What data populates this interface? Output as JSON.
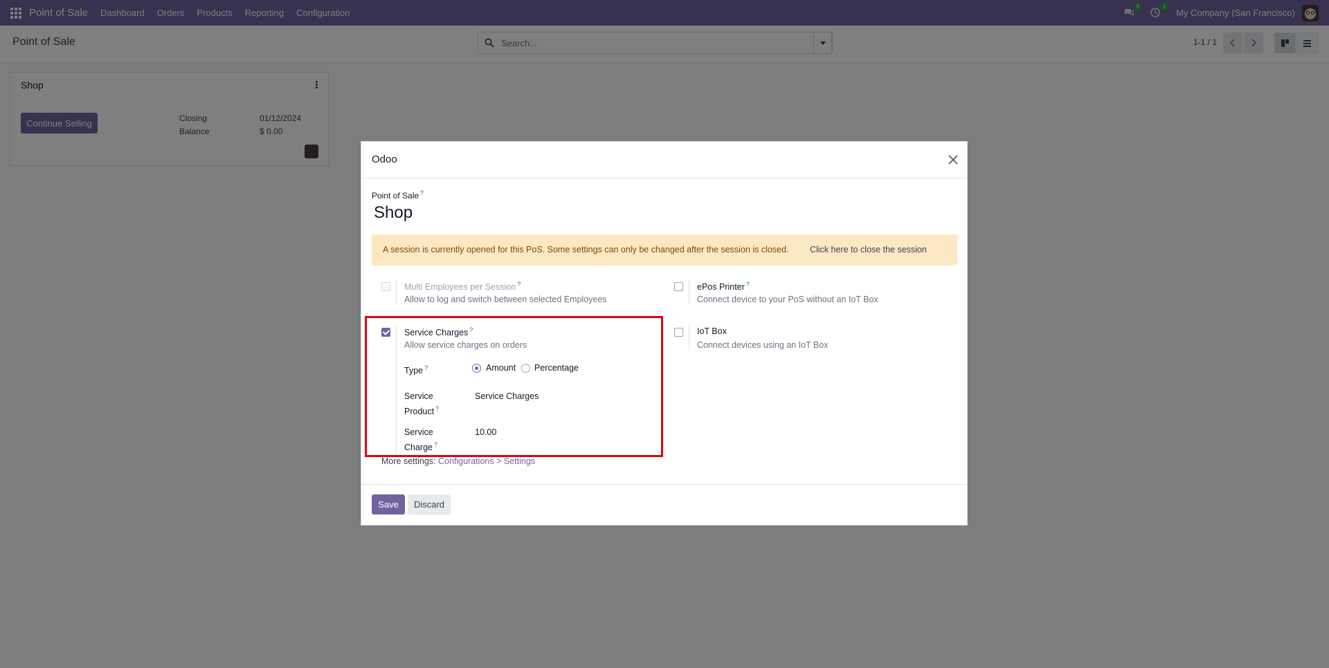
{
  "navbar": {
    "app_name": "Point of Sale",
    "menu": [
      "Dashboard",
      "Orders",
      "Products",
      "Reporting",
      "Configuration"
    ],
    "messages_count": "5",
    "activities_count": "1",
    "company": "My Company (San Francisco)"
  },
  "control_panel": {
    "title": "Point of Sale",
    "search_placeholder": "Search...",
    "pager": "1-1 / 1"
  },
  "kanban": {
    "title": "Shop",
    "continue_label": "Continue Selling",
    "closing_label": "Closing",
    "closing_value": "01/12/2024",
    "balance_label": "Balance",
    "balance_value": "$ 0.00"
  },
  "modal": {
    "title": "Odoo",
    "pos_label": "Point of Sale",
    "help_mark": "?",
    "shop_name": "Shop",
    "alert_message": "A session is currently opened for this PoS. Some settings can only be changed after the session is closed.",
    "alert_link": "Click here to close the session",
    "settings": {
      "multi_employees": {
        "title": "Multi Employees per Session",
        "desc": "Allow to log and switch between selected Employees",
        "checked": false
      },
      "epos_printer": {
        "title": "ePos Printer",
        "desc": "Connect device to your PoS without an IoT Box",
        "checked": false
      },
      "service_charges": {
        "title": "Service Charges",
        "desc": "Allow service charges on orders",
        "checked": true
      },
      "iot_box": {
        "title": "IoT Box",
        "desc": "Connect devices using an IoT Box",
        "checked": false
      }
    },
    "type_label": "Type",
    "type_options": [
      "Amount",
      "Percentage"
    ],
    "type_selected": "Amount",
    "service_product_label_1": "Service",
    "service_product_label_2": "Product",
    "service_product_value": "Service Charges",
    "service_charge_label_1": "Service",
    "service_charge_label_2": "Charge",
    "service_charge_value": "10.00",
    "more_settings_prefix": "More settings:",
    "more_settings_link": "Configurations > Settings",
    "save_label": "Save",
    "discard_label": "Discard"
  },
  "colors": {
    "brand": "#71639e",
    "highlight": "#e1000f",
    "alert_bg": "#fde8c4"
  }
}
